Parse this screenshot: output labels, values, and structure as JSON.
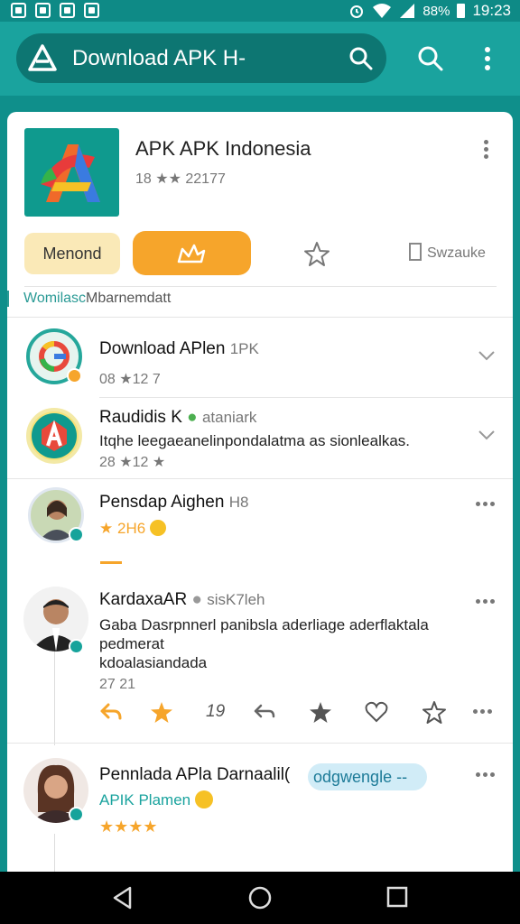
{
  "status_bar": {
    "battery": "88%",
    "time": "19:23"
  },
  "app_bar": {
    "title": "Download APK H-"
  },
  "app": {
    "name": "APK APK Indonesia",
    "meta": "18 ★★ 22177"
  },
  "action_row": {
    "menond_label": "Menond",
    "subscribe_label": "Swzauke"
  },
  "section": {
    "label_accent": "Womilasc",
    "label_rest": "Mbarnemdatt"
  },
  "items": [
    {
      "title": "Download APlen",
      "title_extra": "1PK",
      "meta": "08 ★12 7"
    },
    {
      "title": "Raudidis K",
      "title_extra": "ataniark",
      "body": "Itqhe leegaeanelinpondalatma as sionlealkas.",
      "meta": "28 ★12 ★"
    },
    {
      "title": "Pensdap Aighen",
      "title_extra": "H8",
      "rating_text": "2H6",
      "accent": "#f6a52b"
    }
  ],
  "review": {
    "author": "KardaxaAR",
    "author_extra": "sisK7leh",
    "body": [
      "Gaba Dasrpnnerl panibsla aderliage aderflaktala",
      "pedmerat",
      "kdoalasiandada"
    ],
    "meta": "27 21",
    "action_count": "19"
  },
  "last_item": {
    "title": "Pennlada APla Darnaalil(",
    "chip": "odgwengle --",
    "subtitle": "APIK Plamen",
    "stars": "★★★★"
  },
  "colors": {
    "teal": "#1aa39e",
    "orange": "#f6a52b",
    "cream": "#fae9b7"
  }
}
